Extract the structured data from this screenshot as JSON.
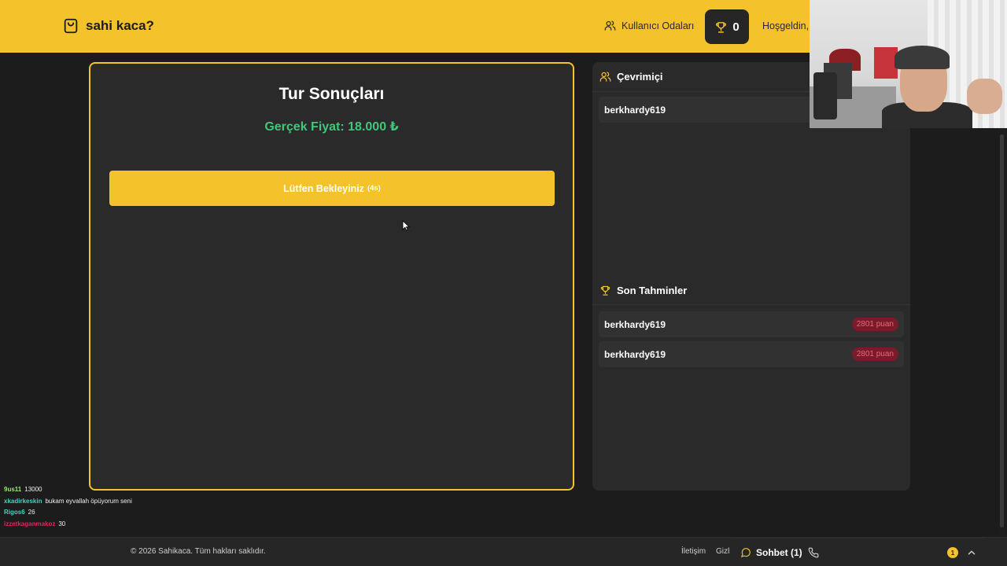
{
  "header": {
    "brand": "sahi kaca?",
    "rooms_label": "Kullanıcı Odaları",
    "score": "0",
    "welcome": "Hoşgeldin,"
  },
  "game": {
    "title": "Tur Sonuçları",
    "real_price": "Gerçek Fiyat: 18.000 ₺",
    "wait_label": "Lütfen Bekleyiniz",
    "countdown": "(4s)"
  },
  "sidebar": {
    "online_title": "Çevrimiçi",
    "online_users": [
      "berkhardy619"
    ],
    "guesses_title": "Son Tahminler",
    "guesses": [
      {
        "user": "berkhardy619",
        "points": "2801 puan"
      },
      {
        "user": "berkhardy619",
        "points": "2801 puan"
      }
    ]
  },
  "stream_chat": [
    {
      "user": "9us11",
      "message": "13000",
      "color": "#9be86a"
    },
    {
      "user": "xkadirkeskin",
      "message": "bukam eyvallah öpüyorum seni",
      "color": "#4ad0c0"
    },
    {
      "user": "Rigos6",
      "message": "26",
      "color": "#4ad0c0"
    },
    {
      "user": "izzetkaganmakoz",
      "message": "30",
      "color": "#e0245e"
    }
  ],
  "footer": {
    "copyright": "© 2026 Sahikaca. Tüm hakları saklıdır.",
    "contact": "İletişim",
    "privacy": "Gizlilik",
    "chat_label": "Sohbet (1)",
    "unread": "1"
  },
  "colors": {
    "accent": "#f4c22b",
    "price_green": "#3fc77a",
    "panel": "#2a2a2a",
    "background": "#1c1c1c",
    "points_badge": "#7a1a2b"
  },
  "icons": {
    "brand": "shopping-bag-icon",
    "rooms": "users-icon",
    "score": "trophy-icon",
    "online": "users-icon",
    "guesses": "trophy-icon",
    "chat": "message-circle-icon",
    "call": "phone-icon",
    "expand": "chevron-up-icon"
  }
}
